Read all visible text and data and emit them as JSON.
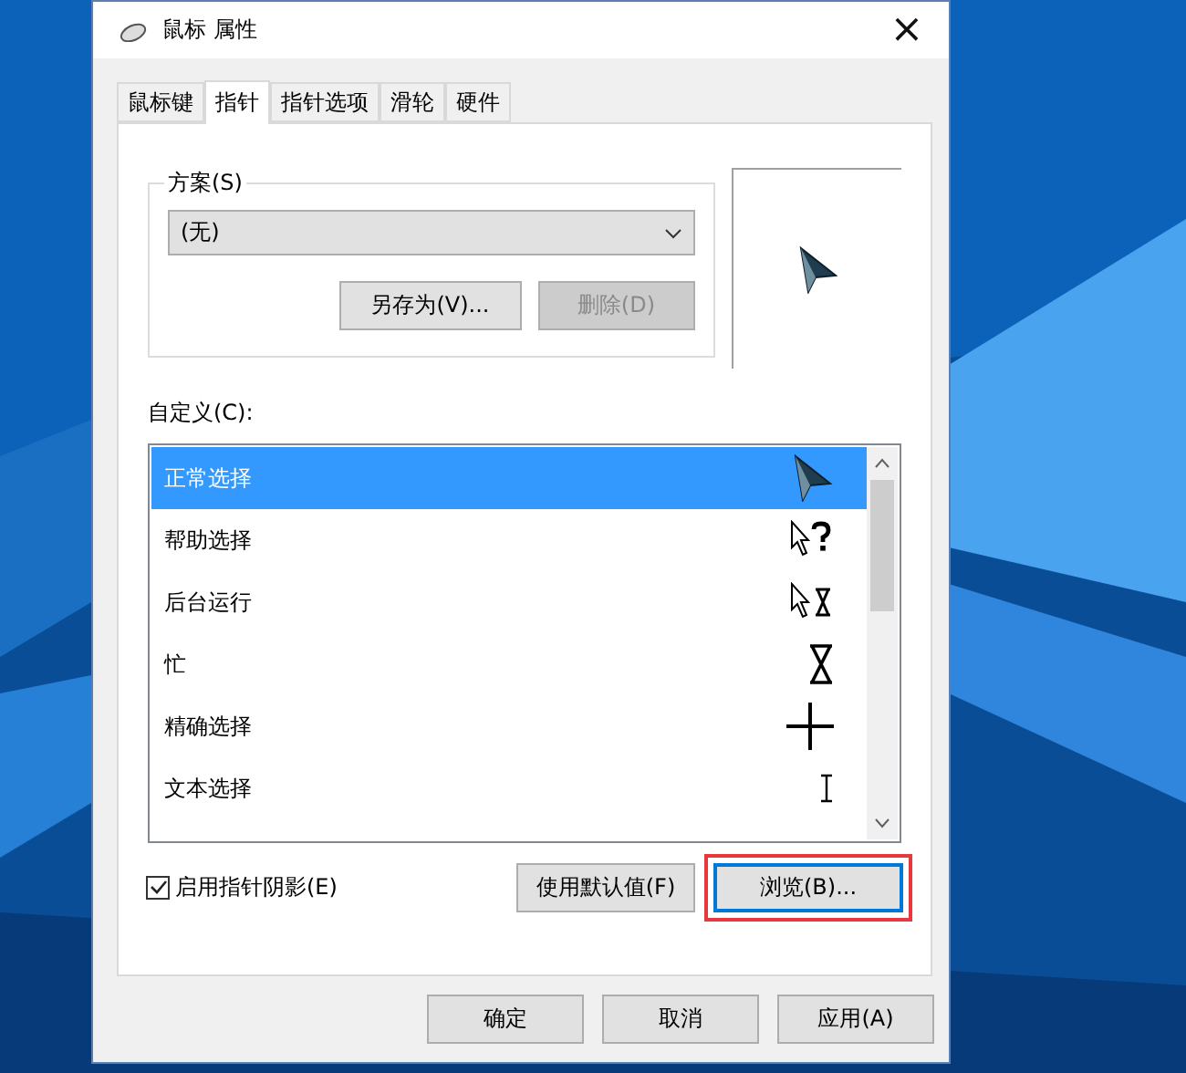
{
  "window": {
    "title": "鼠标 属性",
    "close": "×"
  },
  "tabs": [
    {
      "label": "鼠标键",
      "selected": false
    },
    {
      "label": "指针",
      "selected": true
    },
    {
      "label": "指针选项",
      "selected": false
    },
    {
      "label": "滑轮",
      "selected": false
    },
    {
      "label": "硬件",
      "selected": false
    }
  ],
  "scheme": {
    "label": "方案(S)",
    "value": "(无)",
    "buttons": [
      {
        "label": "另存为(V)...",
        "disabled": false
      },
      {
        "label": "删除(D)",
        "disabled": true
      }
    ]
  },
  "customize_label": "自定义(C):",
  "cursors": [
    {
      "name": "正常选择",
      "kind": "arrow3d",
      "selected": true
    },
    {
      "name": "帮助选择",
      "kind": "help",
      "selected": false
    },
    {
      "name": "后台运行",
      "kind": "working",
      "selected": false
    },
    {
      "name": "忙",
      "kind": "busy",
      "selected": false
    },
    {
      "name": "精确选择",
      "kind": "cross",
      "selected": false
    },
    {
      "name": "文本选择",
      "kind": "text",
      "selected": false
    }
  ],
  "shadow": {
    "label": "启用指针阴影(E)",
    "checked": true
  },
  "actions": [
    {
      "label": "使用默认值(F)",
      "focused": false
    },
    {
      "label": "浏览(B)...",
      "focused": true,
      "highlighted": true
    }
  ],
  "footer": [
    {
      "label": "确定"
    },
    {
      "label": "取消"
    },
    {
      "label": "应用(A)"
    }
  ]
}
